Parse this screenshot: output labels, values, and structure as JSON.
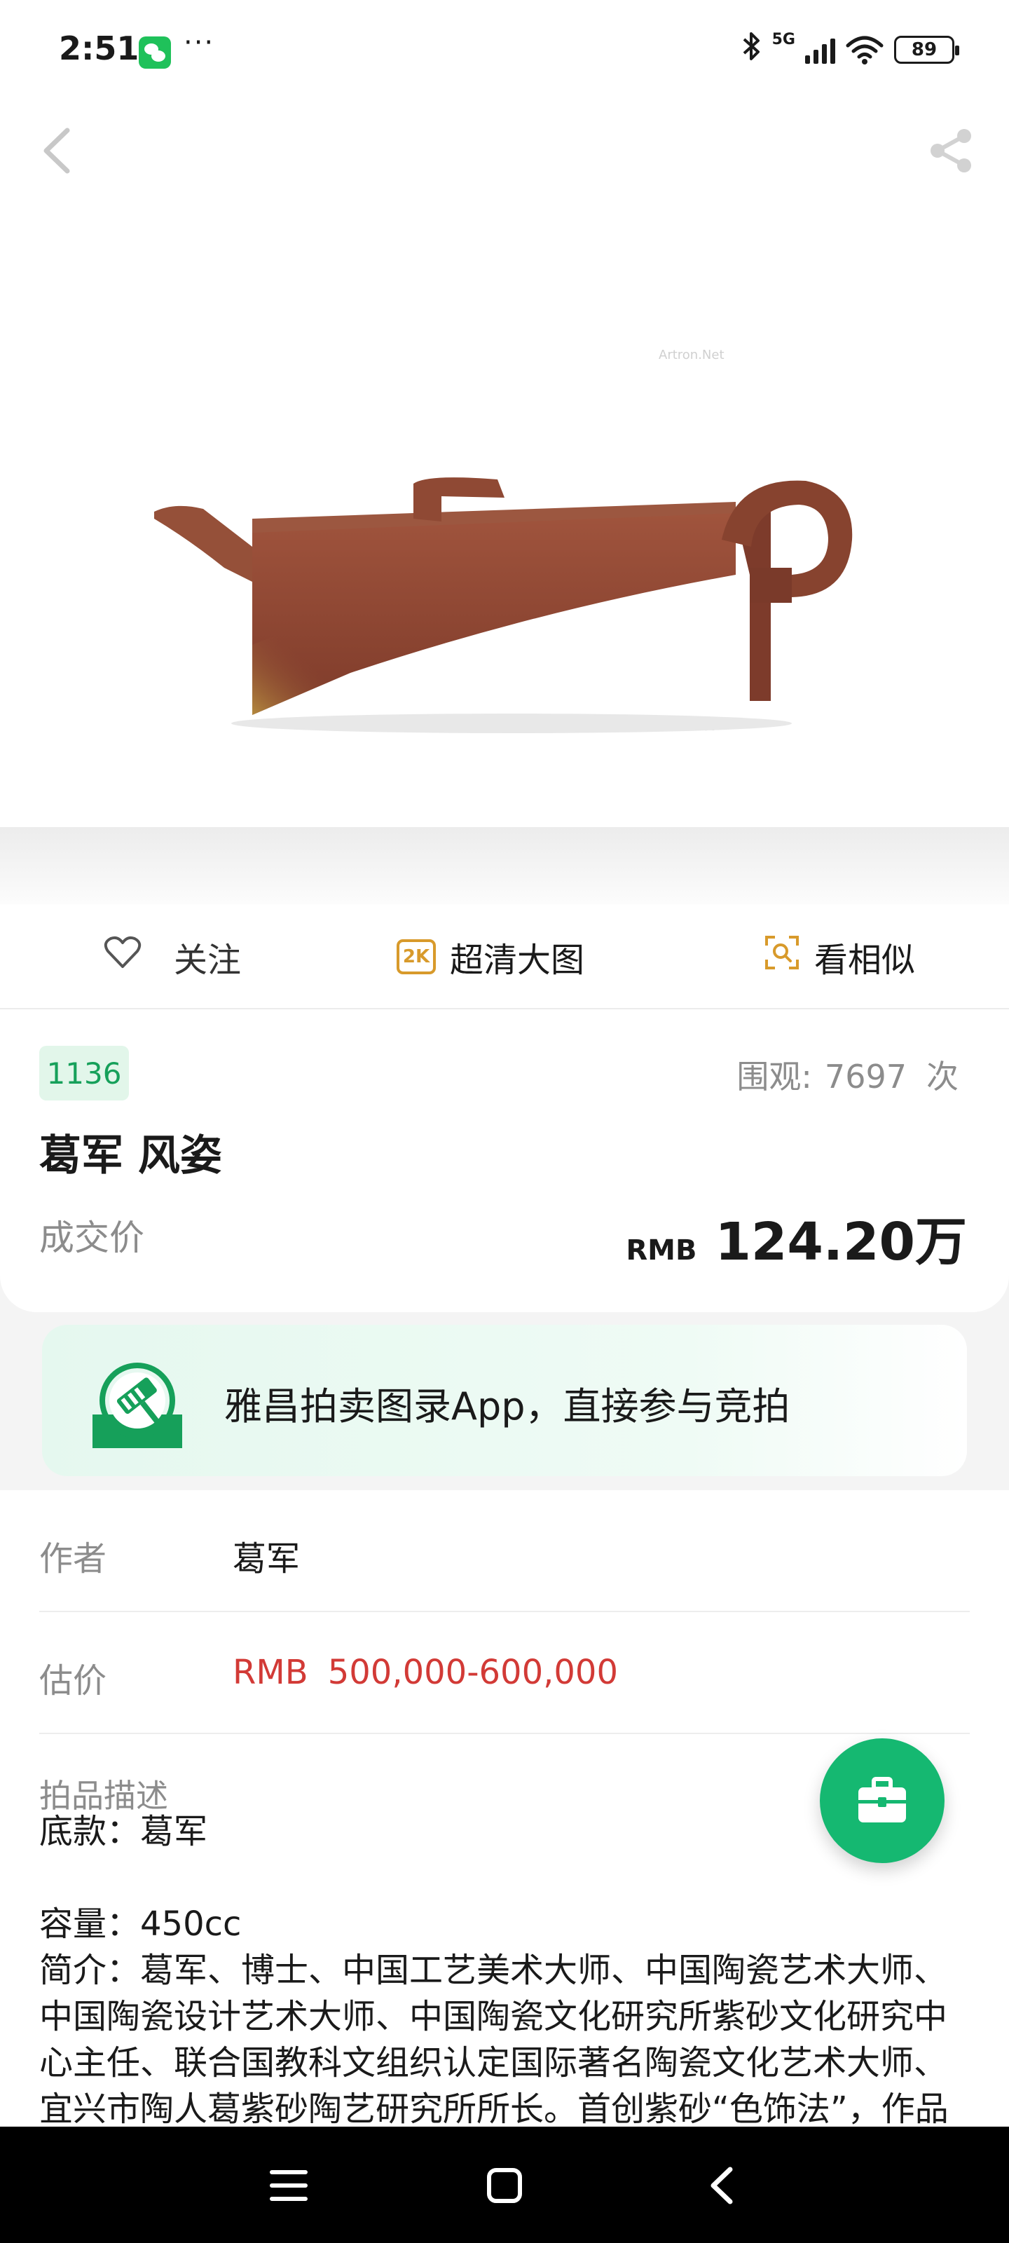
{
  "status_bar": {
    "time": "2:51",
    "more_dots": "···",
    "network_label": "5G",
    "battery_level": "89",
    "icons": [
      "wechat-icon",
      "bluetooth-icon",
      "signal-icon",
      "wifi-icon",
      "battery-icon"
    ]
  },
  "hero": {
    "image_subject": "teapot",
    "watermark": "Artron.Net",
    "icons": [
      "back-arrow-icon",
      "share-icon"
    ]
  },
  "actions": {
    "follow_label": "关注",
    "hd_badge": "2K",
    "hd_label": "超清大图",
    "similar_label": "看相似"
  },
  "lot": {
    "number": "1136",
    "views_label": "围观:",
    "views_count": "7697",
    "views_unit": "次",
    "title": "葛军 风姿",
    "price_label": "成交价",
    "price_currency": "RMB",
    "price_value": "124.20万"
  },
  "promo": {
    "text": "雅昌拍卖图录App，直接参与竞拍",
    "accent": "#16a05a"
  },
  "details": {
    "author_label": "作者",
    "author_value": "葛军",
    "estimate_label": "估价",
    "estimate_currency": "RMB",
    "estimate_value": "500,000-600,000",
    "description_label": "拍品描述",
    "description_text": "底款：葛军\n\n容量：450cc\n简介：葛军、博士、中国工艺美术大师、中国陶瓷艺术大师、中国陶瓷设计艺术大师、中国陶瓷文化研究所紫砂文化研究中心主任、联合国教科文组织认定国际著名陶瓷文化艺术大师、宜兴市陶人葛紫砂陶艺研究所所长。首创紫砂“色饰法”，作品"
  },
  "colors": {
    "accent_green": "#15b871",
    "price_red": "#d23a36",
    "hd_gold": "#d89a2b"
  }
}
